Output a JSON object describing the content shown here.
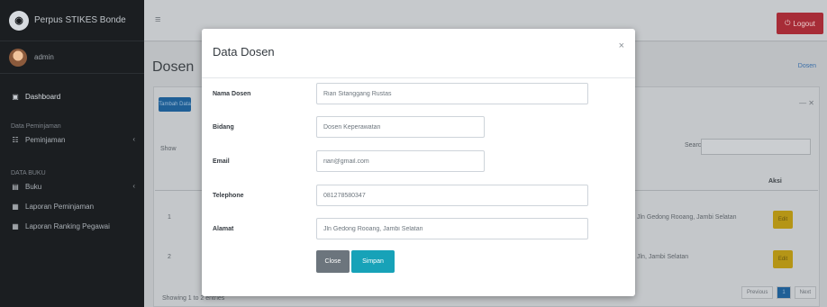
{
  "app": {
    "brand": "Perpus STIKES Bonde",
    "user": "admin"
  },
  "sidebar": {
    "items": [
      {
        "label": "Dashboard",
        "icon": "dashboard-icon"
      },
      {
        "header": "Data Peminjaman"
      },
      {
        "label": "Peminjaman",
        "icon": "list-icon"
      },
      {
        "header": "DATA BUKU"
      },
      {
        "label": "Buku",
        "icon": "book-icon"
      },
      {
        "label": "Laporan Peminjaman",
        "icon": "report-icon"
      },
      {
        "label": "Laporan Ranking Pegawai",
        "icon": "report-icon"
      }
    ]
  },
  "topbar": {
    "logout_label": "Logout"
  },
  "page": {
    "title": "Dosen",
    "breadcrumb": "Dosen",
    "add_button": "Tambah Data",
    "show_label": "Show",
    "search_label": "Search:",
    "aksi_header": "Aksi",
    "rows": [
      {
        "no": "1",
        "alamat": "Jln Gedong Rooang, Jambi Selatan",
        "aksi": "Edit"
      },
      {
        "no": "2",
        "alamat": "Jln, Jambi Selatan",
        "aksi": "Edit"
      }
    ],
    "showing": "Showing 1 to 2 entries",
    "pagination": [
      "Previous",
      "1",
      "Next"
    ]
  },
  "modal": {
    "title": "Data Dosen",
    "close_icon": "×",
    "fields": [
      {
        "label": "Nama Dosen",
        "value": "Rian Sitanggang Rustas"
      },
      {
        "label": "Bidang",
        "value": "Dosen Keperawatan"
      },
      {
        "label": "Email",
        "value": "rian@gmail.com"
      },
      {
        "label": "Telephone",
        "value": "081278580347"
      },
      {
        "label": "Alamat",
        "value": "Jln Gedong Rooang, Jambi Selatan"
      }
    ],
    "close_button": "Close",
    "save_button": "Simpan"
  },
  "colors": {
    "primary": "#1f5f96",
    "info": "#17a2b8",
    "secondary": "#6c757d",
    "danger": "#a72c37",
    "warning": "#b59516",
    "sidebar": "#1b1e21"
  }
}
